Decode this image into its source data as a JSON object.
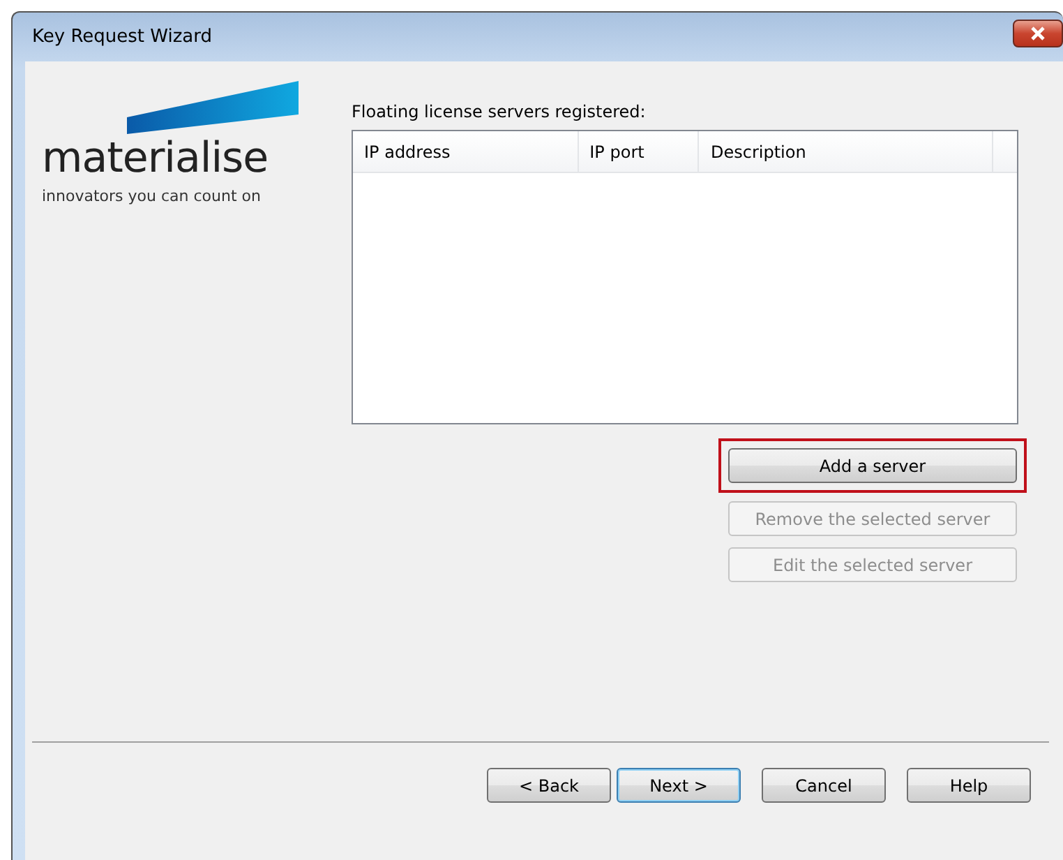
{
  "window": {
    "title": "Key Request Wizard"
  },
  "logo": {
    "name": "materialise",
    "tagline": "innovators you can count on"
  },
  "servers_label": "Floating license servers registered:",
  "table": {
    "columns": [
      "IP address",
      "IP port",
      "Description"
    ]
  },
  "side_buttons": [
    {
      "label": "Add a server",
      "disabled": false,
      "highlighted": true
    },
    {
      "label": "Remove the selected server",
      "disabled": true,
      "highlighted": false
    },
    {
      "label": "Edit the selected server",
      "disabled": true,
      "highlighted": false
    }
  ],
  "nav_buttons": [
    {
      "label": "< Back",
      "default": false
    },
    {
      "label": "Next >",
      "default": true
    },
    {
      "label": "Cancel",
      "default": false
    },
    {
      "label": "Help",
      "default": false
    }
  ]
}
